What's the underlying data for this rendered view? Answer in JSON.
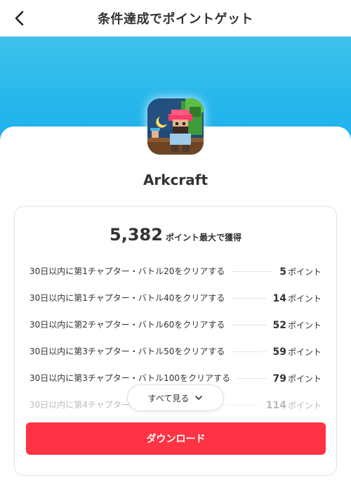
{
  "header": {
    "title": "条件達成でポイントゲット"
  },
  "app": {
    "name": "Arkcraft",
    "icon": "arkcraft-app-icon"
  },
  "summary": {
    "total_points": "5,382",
    "total_label": "ポイント最大で獲得"
  },
  "tasks": [
    {
      "text": "30日以内に第1チャプター・バトル20をクリアする",
      "points": "5",
      "unit": "ポイント"
    },
    {
      "text": "30日以内に第1チャプター・バトル40をクリアする",
      "points": "14",
      "unit": "ポイント"
    },
    {
      "text": "30日以内に第2チャプター・バトル60をクリアする",
      "points": "52",
      "unit": "ポイント"
    },
    {
      "text": "30日以内に第3チャプター・バトル50をクリアする",
      "points": "59",
      "unit": "ポイント"
    },
    {
      "text": "30日以内に第3チャプター・バトル100をクリアする",
      "points": "79",
      "unit": "ポイント"
    },
    {
      "text": "30日以内に第4チャプター",
      "points": "114",
      "unit": "ポイント"
    }
  ],
  "see_all_label": "すべて見る",
  "download_label": "ダウンロード",
  "colors": {
    "hero_top": "#3fc3ec",
    "hero_bottom": "#1eb0ec",
    "download_button": "#ff3344"
  }
}
